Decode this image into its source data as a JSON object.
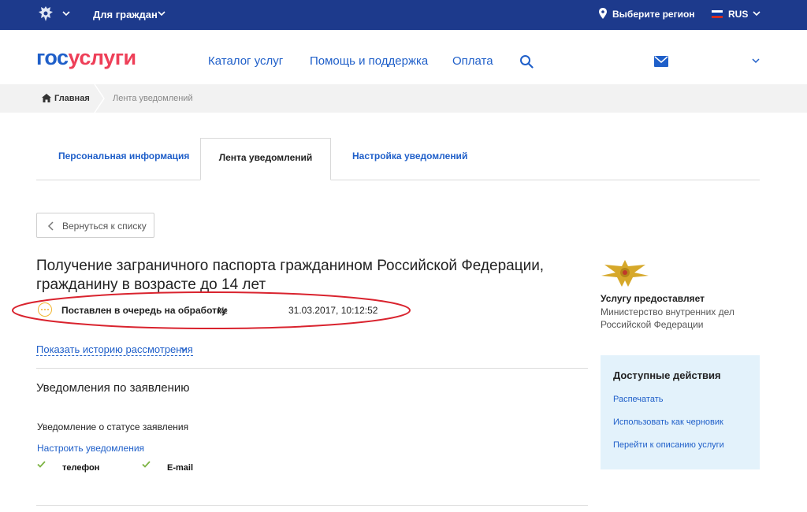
{
  "topbar": {
    "citizens_label": "Для граждан",
    "region_label": "Выберите регион",
    "lang_label": "RUS",
    "flag_colors": [
      "#ffffff",
      "#0039a6",
      "#d52b1e"
    ]
  },
  "header": {
    "logo_part1": "гос",
    "logo_part2": "услуги",
    "nav": [
      "Каталог услуг",
      "Помощь и поддержка",
      "Оплата"
    ],
    "icons": [
      "search-icon",
      "mail-icon",
      "chevron-down-icon"
    ]
  },
  "breadcrumb": {
    "home": "Главная",
    "current": "Лента уведомлений"
  },
  "tabs": {
    "personal": "Персональная информация",
    "feed": "Лента уведомлений",
    "settings": "Настройка уведомлений",
    "active": "Лента уведомлений"
  },
  "back_button": "Вернуться к списку",
  "main": {
    "title": "Получение заграничного паспорта гражданином Российской Федерации, гражданину в возрасте до 14 лет",
    "status": {
      "text": "Поставлен в очередь на обработку",
      "number_label": "№",
      "date": "31.03.2017, 10:12:52",
      "color": "#f2b732"
    },
    "history_link": "Показать историю рассмотрения",
    "notifications_title": "Уведомления по заявлению",
    "status_notification_label": "Уведомление о статусе заявления",
    "configure_link": "Настроить уведомления",
    "channels": [
      "телефон",
      "E-mail"
    ]
  },
  "sidebar": {
    "provider_head": "Услугу предоставляет",
    "provider_name": "Министерство внутренних дел Российской Федерации",
    "actions_title": "Доступные действия",
    "actions": [
      "Распечатать",
      "Использовать как черновик",
      "Перейти к описанию услуги"
    ]
  },
  "colors": {
    "topbar": "#1d3a8c",
    "link": "#1f5fc9",
    "logo_red": "#ee3f58",
    "highlight_ellipse": "#d9232e",
    "actions_bg": "#e3f2fb",
    "check": "#7cb342"
  }
}
